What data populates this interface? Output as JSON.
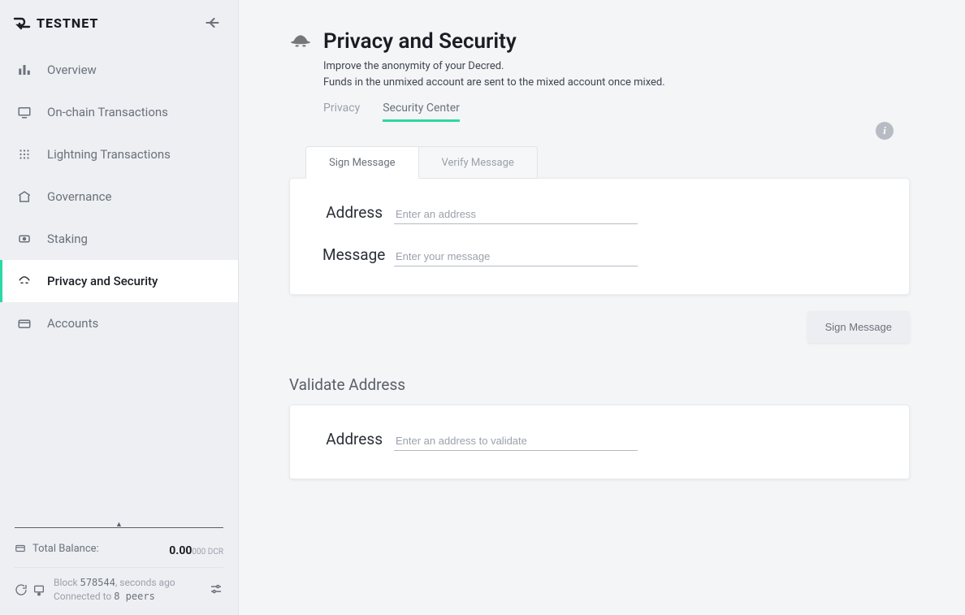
{
  "brand": "TESTNET",
  "sidebar": {
    "items": [
      {
        "label": "Overview"
      },
      {
        "label": "On-chain Transactions"
      },
      {
        "label": "Lightning Transactions"
      },
      {
        "label": "Governance"
      },
      {
        "label": "Staking"
      },
      {
        "label": "Privacy and Security"
      },
      {
        "label": "Accounts"
      }
    ],
    "balance_label": "Total Balance:",
    "balance_main": "0.00",
    "balance_sub": "000 DCR",
    "status": {
      "block_label": "Block",
      "block_height": "578544",
      "block_time": ", seconds ago",
      "connected_label": "Connected to",
      "peers": "8 peers"
    }
  },
  "page": {
    "title": "Privacy and Security",
    "subtitle1": "Improve the anonymity of your Decred.",
    "subtitle2": "Funds in the unmixed account are sent to the mixed account once mixed.",
    "tabs": [
      {
        "label": "Privacy"
      },
      {
        "label": "Security Center"
      }
    ],
    "subtabs": [
      {
        "label": "Sign Message"
      },
      {
        "label": "Verify Message"
      }
    ],
    "form": {
      "address_label": "Address",
      "address_placeholder": "Enter an address",
      "message_label": "Message",
      "message_placeholder": "Enter your message",
      "sign_button": "Sign Message"
    },
    "validate": {
      "section_title": "Validate Address",
      "address_label": "Address",
      "address_placeholder": "Enter an address to validate"
    }
  }
}
